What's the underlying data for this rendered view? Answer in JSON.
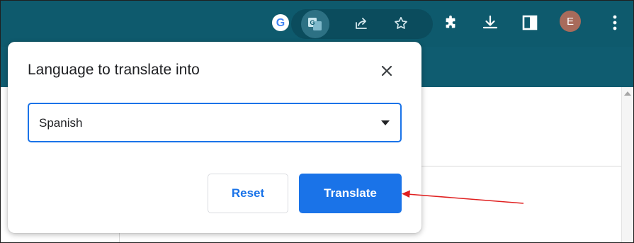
{
  "browser": {
    "toolbar_color": "#0e5a6d",
    "icons": [
      {
        "name": "google-lens-icon",
        "glyph": "G"
      },
      {
        "name": "translate-icon"
      },
      {
        "name": "share-icon"
      },
      {
        "name": "star-icon"
      },
      {
        "name": "extensions-icon"
      },
      {
        "name": "download-icon"
      },
      {
        "name": "side-panel-icon"
      },
      {
        "name": "menu-icon"
      }
    ],
    "profile": {
      "initial": "E",
      "color": "#a86b5b"
    }
  },
  "popup": {
    "title": "Language to translate into",
    "close_icon": "close-icon",
    "language_select": {
      "value": "Spanish"
    },
    "buttons": {
      "reset_label": "Reset",
      "translate_label": "Translate"
    },
    "accent_color": "#1a73e8"
  },
  "annotation": {
    "arrow_color": "#e02020",
    "points_to": "translate-button"
  }
}
